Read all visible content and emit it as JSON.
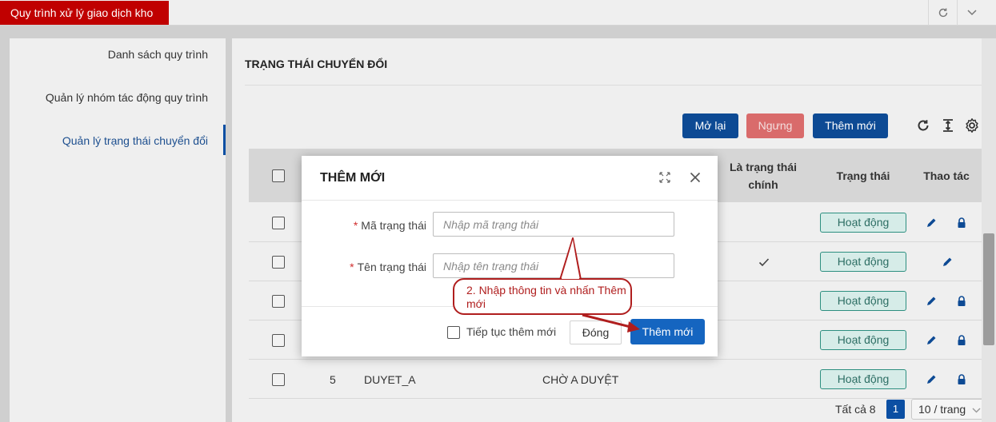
{
  "app": {
    "title": "Quy trình xử lý giao dịch kho"
  },
  "topbar": {
    "refresh_icon": "refresh-icon",
    "collapse_icon": "chevron-down-icon"
  },
  "sidebar": {
    "items": [
      {
        "label": "Danh sách quy trình",
        "active": false
      },
      {
        "label": "Quản lý nhóm tác động quy trình",
        "active": false
      },
      {
        "label": "Quản lý trạng thái chuyển đổi",
        "active": true
      }
    ]
  },
  "main": {
    "section_title": "TRẠNG THÁI CHUYỂN ĐỔI",
    "toolbar": {
      "reopen_label": "Mở lại",
      "stop_label": "Ngưng",
      "add_label": "Thêm mới"
    },
    "table": {
      "headers": {
        "is_main": "Là trạng thái chính",
        "status": "Trạng thái",
        "actions": "Thao tác"
      },
      "rows": [
        {
          "no": "",
          "code": "",
          "name": "",
          "is_main": false,
          "status": "Hoạt động",
          "locked": true
        },
        {
          "no": "",
          "code": "",
          "name": "",
          "is_main": true,
          "status": "Hoạt động",
          "locked": false
        },
        {
          "no": "",
          "code": "",
          "name": "",
          "is_main": false,
          "status": "Hoạt động",
          "locked": true
        },
        {
          "no": "",
          "code": "",
          "name": "",
          "is_main": false,
          "status": "Hoạt động",
          "locked": true
        },
        {
          "no": "5",
          "code": "DUYET_A",
          "name": "CHỜ A DUYỆT",
          "is_main": false,
          "status": "Hoạt động",
          "locked": true
        }
      ]
    },
    "pagination": {
      "total": "Tất cả 8",
      "current_page": "1",
      "page_size": "10 / trang"
    }
  },
  "modal": {
    "title": "THÊM MỚI",
    "fields": {
      "code": {
        "label": "Mã trạng thái",
        "placeholder": "Nhập mã trạng thái",
        "value": ""
      },
      "name": {
        "label": "Tên trạng thái",
        "placeholder": "Nhập tên trạng thái",
        "value": ""
      }
    },
    "continue_label": "Tiếp tục thêm mới",
    "close_label": "Đóng",
    "submit_label": "Thêm mới"
  },
  "callout": {
    "text": "2. Nhập thông tin và nhấn Thêm mới"
  },
  "colors": {
    "brand_red": "#c00000",
    "primary": "#0d4a94",
    "submit": "#1565c0",
    "danger": "#d96b6b",
    "annotation": "#b01e1e",
    "badge_green": "#2d8f80"
  }
}
